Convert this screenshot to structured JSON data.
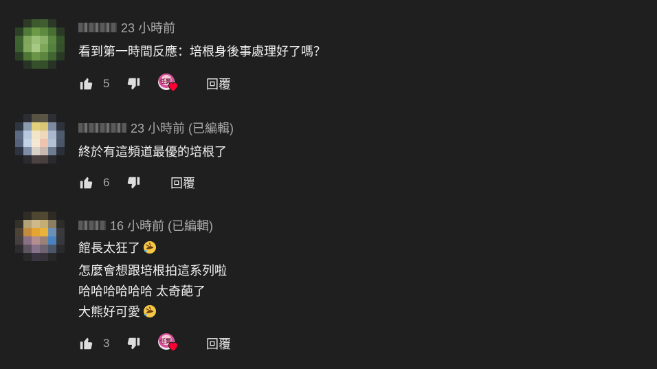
{
  "comments": [
    {
      "time": "23 小時前",
      "lines": [
        "看到第一時間反應：培根身後事處理好了嗎？"
      ],
      "likes": "5",
      "reply_label": "回覆",
      "creator_heart": true
    },
    {
      "time": "23 小時前 (已編輯)",
      "lines": [
        "終於有這頻道最優的培根了"
      ],
      "likes": "6",
      "reply_label": "回覆",
      "creator_heart": false
    },
    {
      "time": "16 小時前 (已編輯)",
      "lines": [
        "館長太狂了",
        "怎麼會想跟培根拍這系列啦",
        "哈哈哈哈哈哈 太奇葩了",
        "大熊好可愛"
      ],
      "likes": "3",
      "reply_label": "回覆",
      "creator_heart": true
    }
  ],
  "icons": {
    "like": "thumb-up-icon",
    "dislike": "thumb-down-icon",
    "heart": "creator-heart-icon",
    "emoji": "rolling-on-floor-laughing-emoji"
  },
  "colors": {
    "background": "#1f1f1f",
    "text": "#f1f1f1",
    "secondary_text": "#aaaaaa",
    "heart": "#ff0033"
  },
  "creator_badge_text": "任賢"
}
